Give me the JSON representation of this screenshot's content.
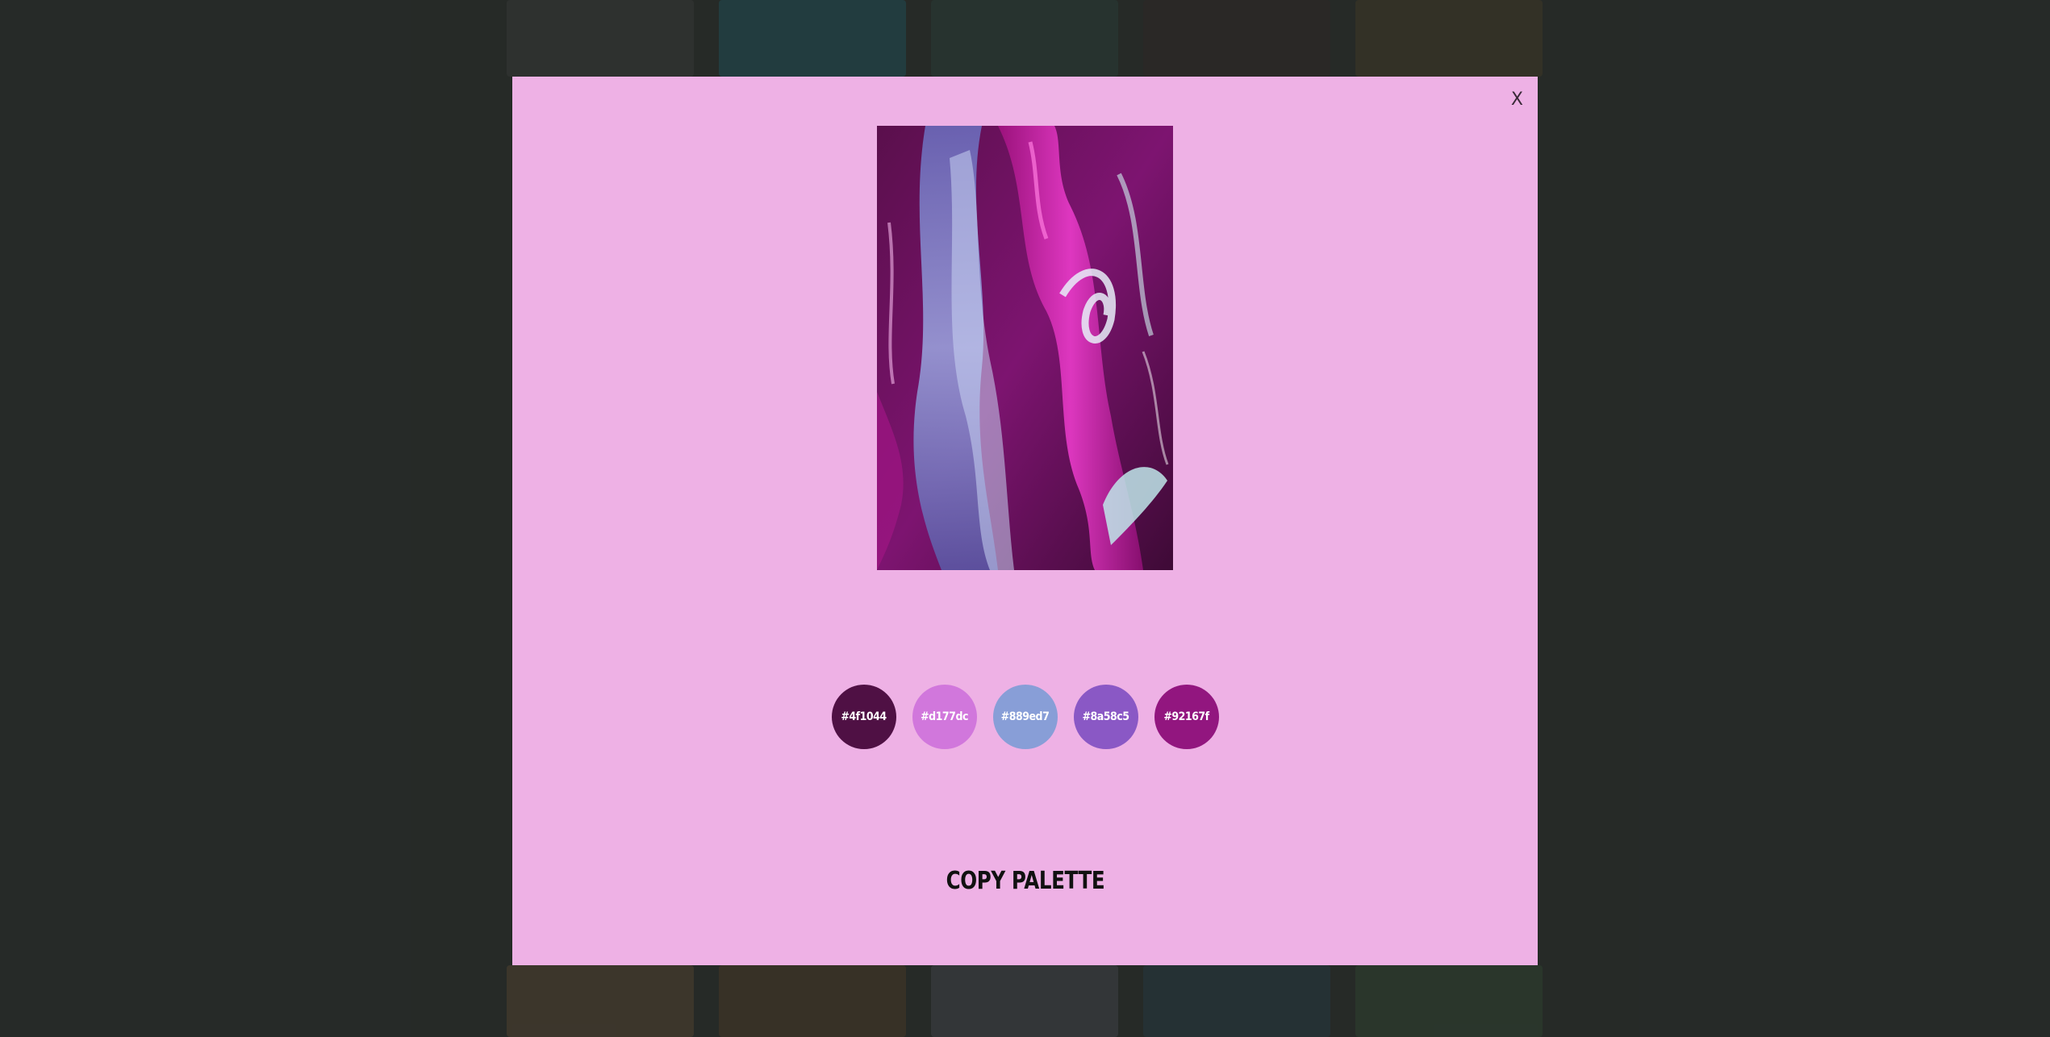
{
  "modal": {
    "close_label": "X",
    "background_color": "#eeb1e5"
  },
  "artwork": {
    "description_icon": "abstract-paint-image"
  },
  "palette": {
    "swatches": [
      {
        "label": "#4f1044",
        "color": "#4f1044"
      },
      {
        "label": "#d177dc",
        "color": "#d177dc"
      },
      {
        "label": "#889ed7",
        "color": "#889ed7"
      },
      {
        "label": "#8a58c5",
        "color": "#8a58c5"
      },
      {
        "label": "#92167f",
        "color": "#92167f"
      }
    ]
  },
  "actions": {
    "copy_label": "COPY PALETTE"
  }
}
